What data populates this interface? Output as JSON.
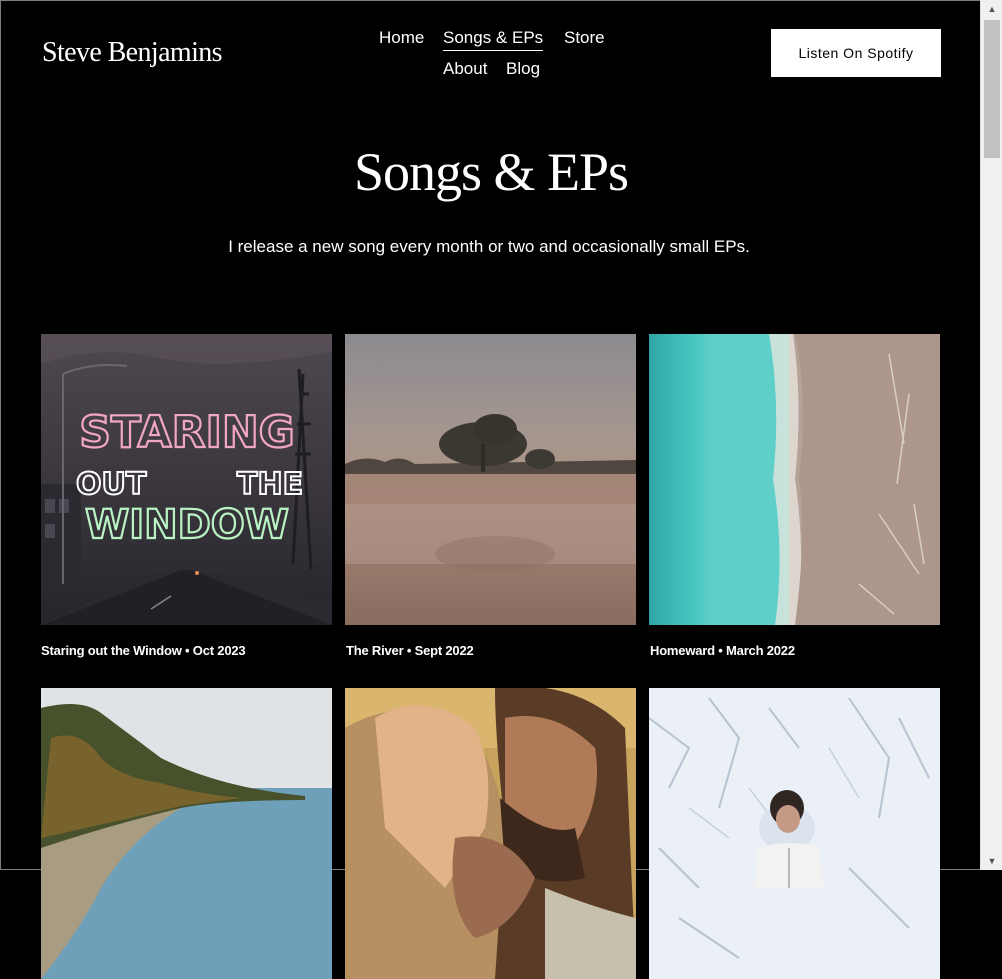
{
  "site": {
    "logo": "Steve Benjamins"
  },
  "nav": {
    "items": [
      {
        "label": "Home",
        "active": false
      },
      {
        "label": "Songs & EPs",
        "active": true
      },
      {
        "label": "Store",
        "active": false
      },
      {
        "label": "About",
        "active": false
      },
      {
        "label": "Blog",
        "active": false
      }
    ]
  },
  "cta": {
    "label": "Listen On Spotify"
  },
  "page": {
    "title": "Songs & EPs",
    "subtitle": "I release a new song every month or two and occasionally small EPs."
  },
  "releases": [
    {
      "caption": "Staring out the Window • Oct 2023",
      "art_text": [
        "STARING",
        "OUT",
        "THE",
        "WINDOW"
      ]
    },
    {
      "caption": "The River • Sept 2022"
    },
    {
      "caption": "Homeward • March 2022"
    },
    {
      "caption": ""
    },
    {
      "caption": ""
    },
    {
      "caption": ""
    }
  ],
  "icons": {
    "scroll_up": "triangle-up-icon",
    "scroll_down": "triangle-down-icon"
  }
}
